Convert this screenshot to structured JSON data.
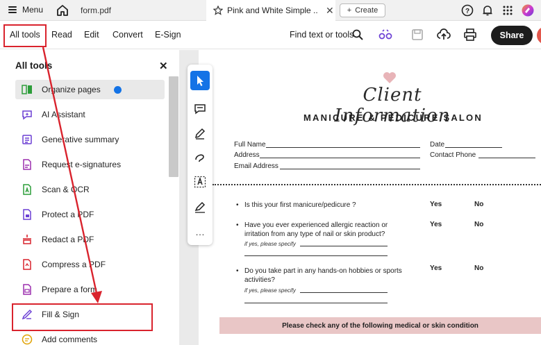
{
  "tabbar": {
    "menu_label": "Menu",
    "file_tab": "form.pdf",
    "active_tab": "Pink and White Simple ...",
    "create_label": "Create"
  },
  "toolbar": {
    "all_tools": "All tools",
    "read": "Read",
    "edit": "Edit",
    "convert": "Convert",
    "esign": "E-Sign",
    "find": "Find text or tools",
    "share": "Share"
  },
  "left_panel": {
    "title": "All tools",
    "items": [
      {
        "label": "Organize pages",
        "icon": "organize-pages-icon",
        "color": "#2d9d3a"
      },
      {
        "label": "AI Assistant",
        "icon": "ai-assistant-icon",
        "color": "#6b3fd4"
      },
      {
        "label": "Generative summary",
        "icon": "generative-summary-icon",
        "color": "#6b3fd4"
      },
      {
        "label": "Request e-signatures",
        "icon": "request-esign-icon",
        "color": "#9b2fae"
      },
      {
        "label": "Scan & OCR",
        "icon": "scan-ocr-icon",
        "color": "#2d9d3a"
      },
      {
        "label": "Protect a PDF",
        "icon": "protect-pdf-icon",
        "color": "#6b3fd4"
      },
      {
        "label": "Redact a PDF",
        "icon": "redact-pdf-icon",
        "color": "#d9232d"
      },
      {
        "label": "Compress a PDF",
        "icon": "compress-pdf-icon",
        "color": "#d9232d"
      },
      {
        "label": "Prepare a form",
        "icon": "prepare-form-icon",
        "color": "#9b2fae"
      },
      {
        "label": "Fill & Sign",
        "icon": "fill-sign-icon",
        "color": "#6b3fd4"
      },
      {
        "label": "Add comments",
        "icon": "add-comments-icon",
        "color": "#e0a100"
      }
    ]
  },
  "document": {
    "title_script": "Client Information",
    "subtitle": "MANICURE & PEDICURE SALON",
    "fields": {
      "full_name": "Full Name",
      "address": "Address",
      "email": "Email Address",
      "date": "Date",
      "contact_phone": "Contact Phone"
    },
    "questions": [
      {
        "text_1": "Is this your first manicure/pedicure ?",
        "yes": "Yes",
        "no": "No"
      },
      {
        "text_1": "Have you ever experienced allergic reaction or",
        "text_2": "irritation from any type of nail or skin product?",
        "specify": "if yes, please specify",
        "yes": "Yes",
        "no": "No"
      },
      {
        "text_1": "Do you take part in any hands-on hobbies or sports",
        "text_2": "activities?",
        "specify": "if yes, please specify",
        "yes": "Yes",
        "no": "No"
      }
    ],
    "condition_bar": "Please check any of the following medical or skin condition"
  },
  "colors": {
    "accent_blue": "#1473e6",
    "highlight_red": "#d9232d",
    "pink_bar": "#e9c6c6"
  }
}
